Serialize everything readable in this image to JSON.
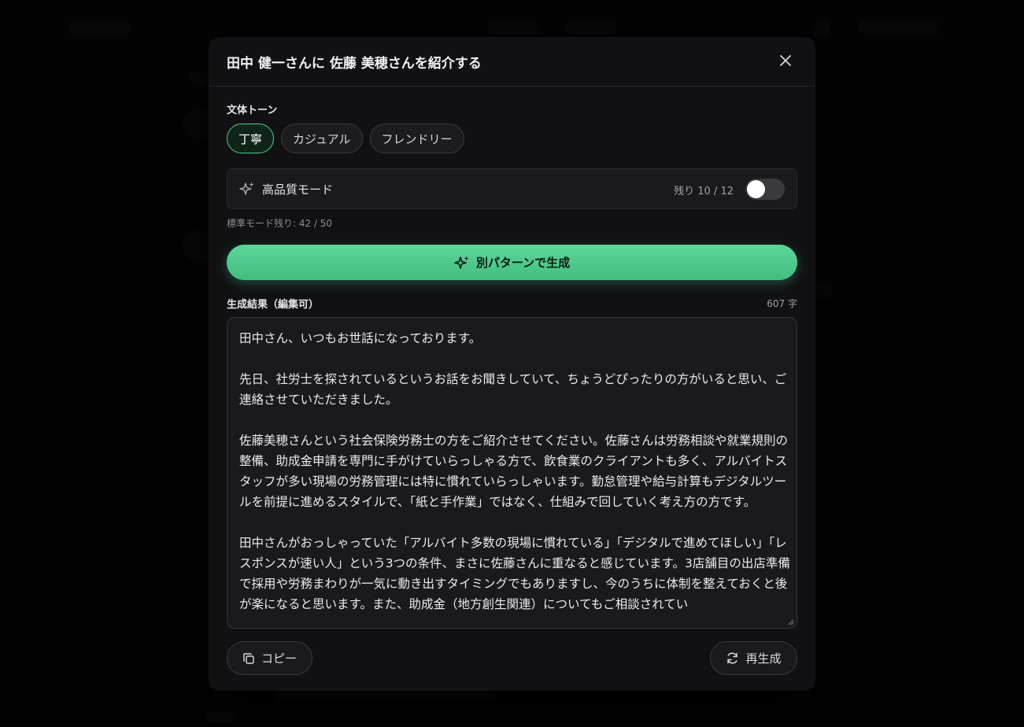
{
  "modal": {
    "title": "田中 健一さんに 佐藤 美穂さんを紹介する",
    "close_icon": "close-icon"
  },
  "tone": {
    "label": "文体トーン",
    "options": [
      {
        "label": "丁寧",
        "active": true
      },
      {
        "label": "カジュアル",
        "active": false
      },
      {
        "label": "フレンドリー",
        "active": false
      }
    ]
  },
  "high_quality": {
    "icon": "sparkles-icon",
    "label": "高品質モード",
    "remaining": "残り 10 / 12",
    "enabled": false
  },
  "standard_remaining": "標準モード残り: 42 / 50",
  "generate_button": {
    "icon": "sparkles-icon",
    "label": "別パターンで生成"
  },
  "result": {
    "label": "生成結果（編集可）",
    "char_count": "607 字",
    "text": "田中さん、いつもお世話になっております。\n\n先日、社労士を探されているというお話をお聞きしていて、ちょうどぴったりの方がいると思い、ご連絡させていただきました。\n\n佐藤美穂さんという社会保険労務士の方をご紹介させてください。佐藤さんは労務相談や就業規則の整備、助成金申請を専門に手がけていらっしゃる方で、飲食業のクライアントも多く、アルバイトスタッフが多い現場の労務管理には特に慣れていらっしゃいます。勤怠管理や給与計算もデジタルツールを前提に進めるスタイルで、「紙と手作業」ではなく、仕組みで回していく考え方の方です。\n\n田中さんがおっしゃっていた「アルバイト多数の現場に慣れている」「デジタルで進めてほしい」「レスポンスが速い人」という3つの条件、まさに佐藤さんに重なると感じています。3店舗目の出店準備で採用や労務まわりが一気に動き出すタイミングでもありますし、今のうちに体制を整えておくと後が楽になると思います。また、助成金（地方創生関連）についてもご相談されてい"
  },
  "footer": {
    "copy_icon": "copy-icon",
    "copy_label": "コピー",
    "regen_icon": "refresh-icon",
    "regen_label": "再生成"
  },
  "colors": {
    "accent": "#4fd08f",
    "modal_bg": "#111113"
  }
}
